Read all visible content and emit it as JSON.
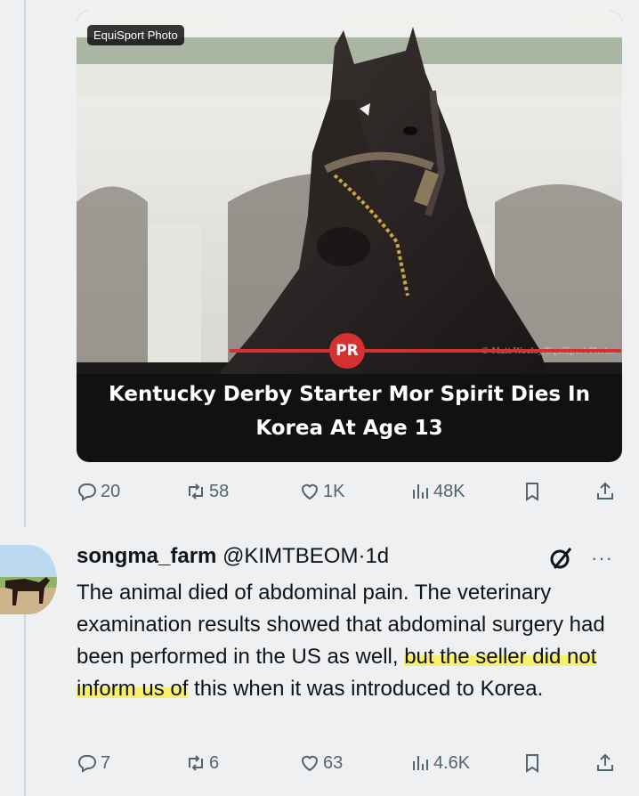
{
  "card": {
    "credit_badge": "EquiSport Photo",
    "watermark": "© Matt Wooley/EquiSport Photos",
    "brand_logo": "PR",
    "headline_line1": "Kentucky Derby Starter Mor Spirit Dies In",
    "headline_line2": "Korea At Age 13"
  },
  "post_actions": {
    "replies": "20",
    "reposts": "58",
    "likes": "1K",
    "views": "48K"
  },
  "reply": {
    "name": "songma_farm",
    "handle": "@KIMTBEOM",
    "dot": "·",
    "time": "1d",
    "more": "···",
    "text_part1": "The animal died of abdominal pain. The veterinary examination results showed that abdominal surgery had been performed in the US as well, ",
    "text_highlight": "but the seller did not inform us of",
    "text_part2": " this when it was introduced to Korea.",
    "actions": {
      "replies": "7",
      "reposts": "6",
      "likes": "63",
      "views": "4.6K"
    }
  },
  "icons": {
    "reply": "comment-icon",
    "repost": "repost-icon",
    "like": "heart-icon",
    "views": "views-icon",
    "bookmark": "bookmark-icon",
    "share": "share-icon",
    "grok": "grok-icon"
  },
  "colors": {
    "background": "#eef0f1",
    "icon_gray": "#536471",
    "brand_red": "#d63031",
    "highlight": "#f8f06a"
  }
}
